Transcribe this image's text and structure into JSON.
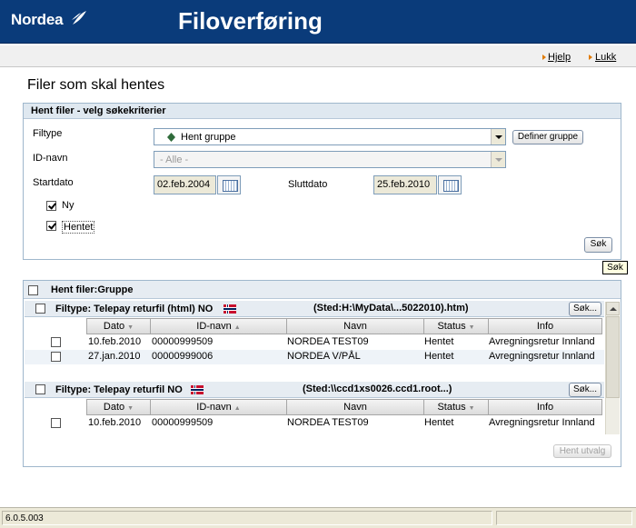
{
  "header": {
    "logo_text": "Nordea",
    "title": "Filoverføring",
    "brand_color": "#0a3b7a"
  },
  "links": {
    "help": "Hjelp",
    "close": "Lukk"
  },
  "page_title": "Filer som skal hentes",
  "criteria": {
    "heading": "Hent filer - velg søkekriterier",
    "filetype_label": "Filtype",
    "filetype_value": "Hent gruppe",
    "define_group_button": "Definer gruppe",
    "id_label": "ID-navn",
    "id_value": "- Alle -",
    "start_label": "Startdato",
    "start_value": "02.feb.2004",
    "end_label": "Sluttdato",
    "end_value": "25.feb.2010",
    "new_label": "Ny",
    "fetched_label": "Hentet",
    "search_button": "Søk",
    "tooltip": "Søk"
  },
  "results": {
    "heading": "Hent filer:Gruppe",
    "columns": [
      "Dato",
      "ID-navn",
      "Navn",
      "Status",
      "Info"
    ],
    "groups": [
      {
        "title": "Filtype: Telepay returfil (html) NO",
        "location": "(Sted:H:\\MyData\\...5022010).htm)",
        "search_button": "Søk...",
        "rows": [
          [
            "10.feb.2010",
            "00000999509",
            "NORDEA  TEST09",
            "Hentet",
            "Avregningsretur Innland"
          ],
          [
            "27.jan.2010",
            "00000999006",
            "NORDEA V/PÅL",
            "Hentet",
            "Avregningsretur Innland"
          ]
        ]
      },
      {
        "title": "Filtype: Telepay returfil NO",
        "location": "(Sted:\\\\ccd1xs0026.ccd1.root...)",
        "search_button": "Søk...",
        "rows": [
          [
            "10.feb.2010",
            "00000999509",
            "NORDEA  TEST09",
            "Hentet",
            "Avregningsretur Innland"
          ]
        ]
      }
    ],
    "fetch_selection_button": "Hent utvalg"
  },
  "status": {
    "version": "6.0.5.003"
  }
}
